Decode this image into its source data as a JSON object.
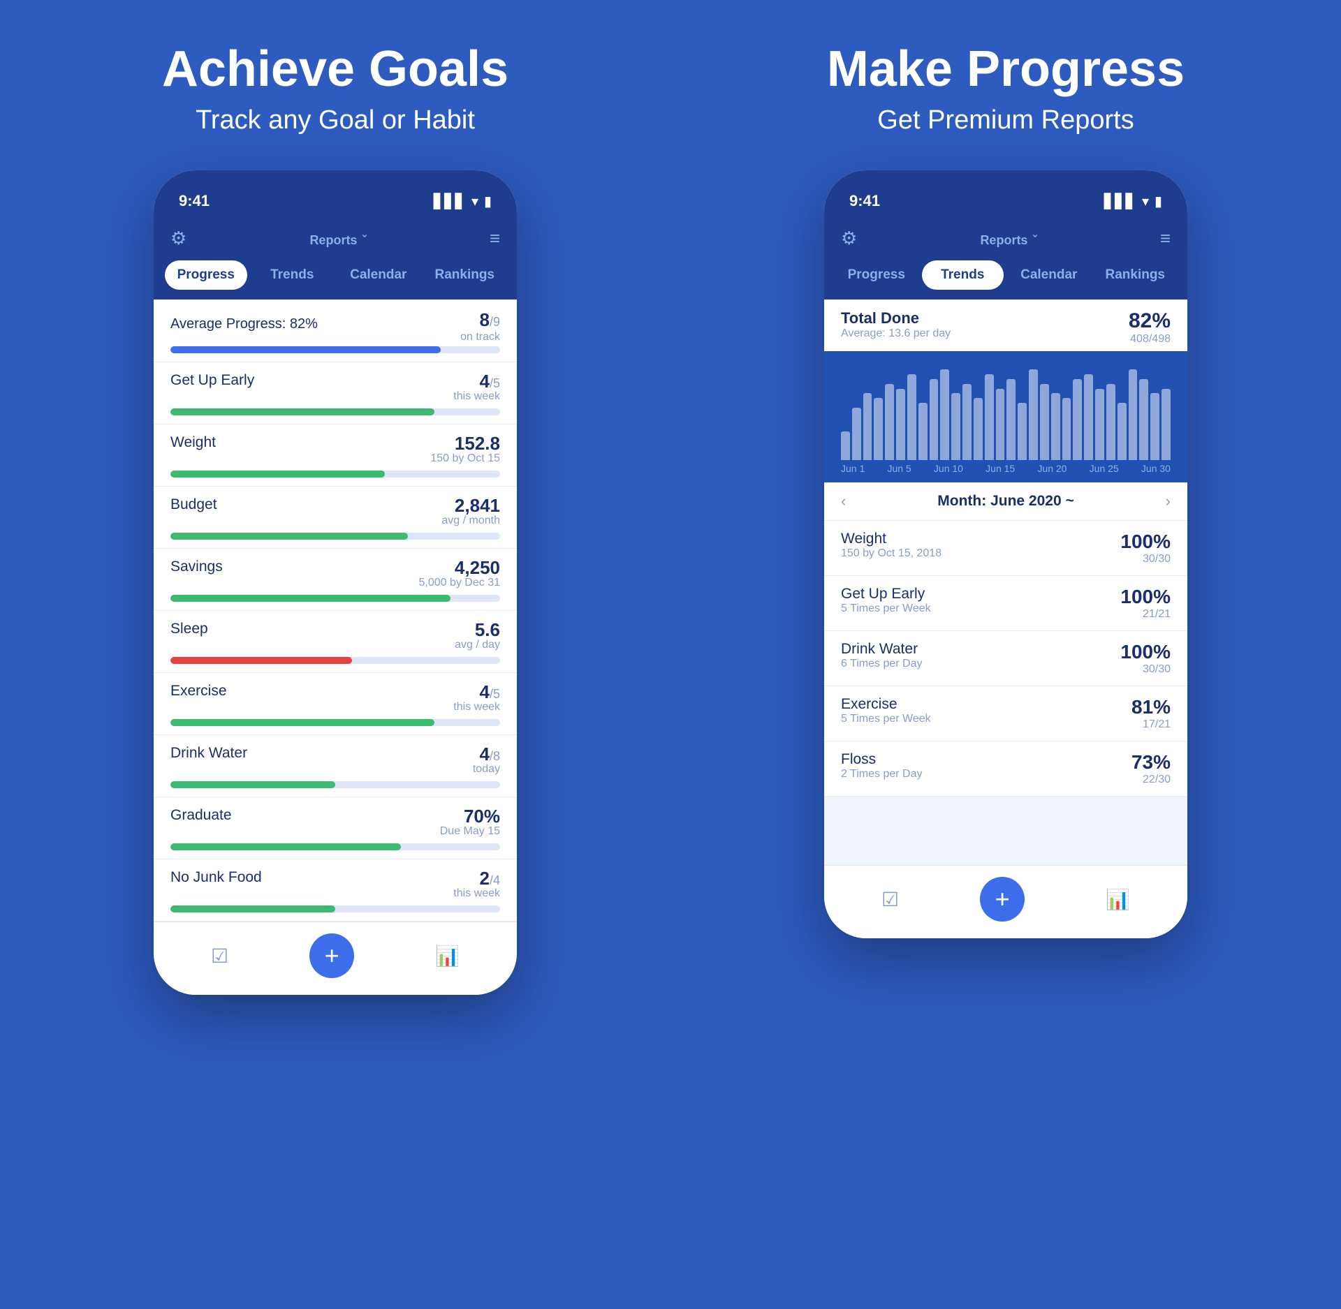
{
  "left_panel": {
    "title": "Achieve Goals",
    "subtitle": "Track any Goal or Habit",
    "phone": {
      "status_time": "9:41",
      "status_icons": "▋▋▋ ◀ ▮",
      "header_title": "Reports",
      "header_arrow": "ˇ",
      "tabs": [
        "Progress",
        "Trends",
        "Calendar",
        "Rankings"
      ],
      "active_tab": 0,
      "avg_label": "Average Progress: 82%",
      "avg_value": "8",
      "avg_sub": "/9",
      "avg_meta": "on track",
      "goals": [
        {
          "name": "Get Up Early",
          "value": "4",
          "sub": "/5",
          "meta": "this week",
          "pct": 80,
          "color": "green"
        },
        {
          "name": "Weight",
          "value": "152.8",
          "sub": "",
          "meta": "150 by Oct 15",
          "pct": 65,
          "color": "green"
        },
        {
          "name": "Budget",
          "value": "2,841",
          "sub": "",
          "meta": "avg / month",
          "pct": 72,
          "color": "green"
        },
        {
          "name": "Savings",
          "value": "4,250",
          "sub": "",
          "meta": "5,000 by Dec 31",
          "pct": 85,
          "color": "green"
        },
        {
          "name": "Sleep",
          "value": "5.6",
          "sub": "",
          "meta": "avg / day",
          "pct": 55,
          "color": "red"
        },
        {
          "name": "Exercise",
          "value": "4",
          "sub": "/5",
          "meta": "this week",
          "pct": 80,
          "color": "green"
        },
        {
          "name": "Drink Water",
          "value": "4",
          "sub": "/8",
          "meta": "today",
          "pct": 50,
          "color": "green"
        },
        {
          "name": "Graduate",
          "value": "70%",
          "sub": "",
          "meta": "Due May 15",
          "pct": 70,
          "color": "green"
        },
        {
          "name": "No Junk Food",
          "value": "2",
          "sub": "/4",
          "meta": "this week",
          "pct": 50,
          "color": "green"
        }
      ],
      "nav": {
        "checklist_icon": "☑",
        "add_icon": "+",
        "chart_icon": "📊"
      }
    }
  },
  "right_panel": {
    "title": "Make Progress",
    "subtitle": "Get Premium Reports",
    "phone": {
      "status_time": "9:41",
      "header_title": "Reports",
      "header_arrow": "ˇ",
      "tabs": [
        "Progress",
        "Trends",
        "Calendar",
        "Rankings"
      ],
      "active_tab": 1,
      "total_done": {
        "title": "Total Done",
        "avg": "Average: 13.6 per day",
        "pct": "82%",
        "count": "408/498"
      },
      "chart": {
        "bars": [
          30,
          55,
          70,
          65,
          80,
          75,
          90,
          60,
          85,
          95,
          70,
          80,
          65,
          90,
          75,
          85,
          60,
          95,
          80,
          70,
          65,
          85,
          90,
          75,
          80,
          60,
          95,
          85,
          70,
          75
        ],
        "labels": [
          "Jun 1",
          "Jun 5",
          "Jun 10",
          "Jun 15",
          "Jun 20",
          "Jun 25",
          "Jun 30"
        ]
      },
      "month_label": "Month: June 2020 ~",
      "month_prev": "‹",
      "month_next": "›",
      "trends": [
        {
          "name": "Weight",
          "sub": "150 by Oct 15, 2018",
          "pct": "100%",
          "count": "30/30"
        },
        {
          "name": "Get Up Early",
          "sub": "5 Times per Week",
          "pct": "100%",
          "count": "21/21"
        },
        {
          "name": "Drink Water",
          "sub": "6 Times per Day",
          "pct": "100%",
          "count": "30/30"
        },
        {
          "name": "Exercise",
          "sub": "5 Times per Week",
          "pct": "81%",
          "count": "17/21"
        },
        {
          "name": "Floss",
          "sub": "2 Times per Day",
          "pct": "73%",
          "count": "22/30"
        }
      ],
      "nav": {
        "checklist_icon": "☑",
        "add_icon": "+",
        "chart_icon": "📊"
      }
    }
  }
}
